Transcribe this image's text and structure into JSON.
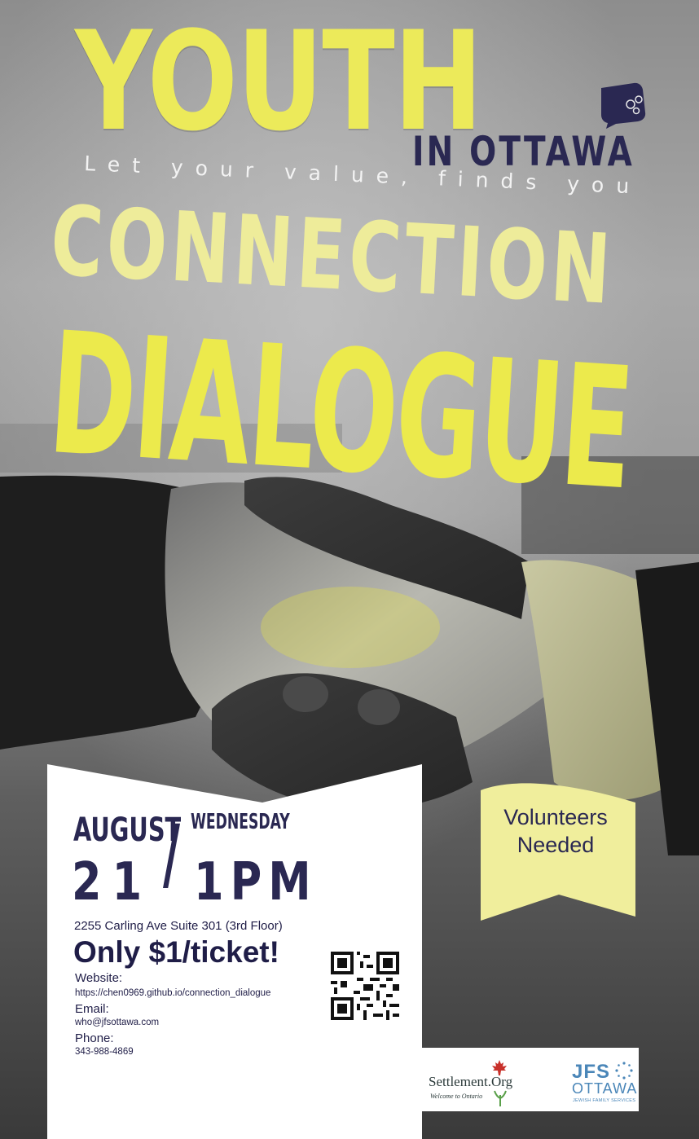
{
  "poster": {
    "title_top": "YOUTH",
    "location": "IN OTTAWA",
    "tagline": "Let your value, finds you",
    "title_mid": "CONNECTION",
    "title_bottom": "DIALOGUE"
  },
  "event": {
    "month": "AUGUST",
    "weekday": "WEDNESDAY",
    "day": "21",
    "time": "1PM",
    "separator": "/",
    "address": "2255 Carling Ave Suite 301 (3rd Floor)",
    "price": "Only $1/ticket!",
    "website_label": "Website:",
    "website": "https://chen0969.github.io/connection_dialogue",
    "email_label": "Email:",
    "email": "who@jfsottawa.com",
    "phone_label": "Phone:",
    "phone": "343-988-4869"
  },
  "ribbon": {
    "line1": "Volunteers",
    "line2": "Needed"
  },
  "logos": {
    "settlement_name": "Settlement.Org",
    "settlement_tagline": "Welcome to Ontario",
    "jfs_name": "JFS",
    "jfs_city": "OTTAWA",
    "jfs_tagline": "JEWISH FAMILY SERVICES"
  },
  "colors": {
    "accent_yellow": "#ecea4c",
    "pale_yellow": "#eeec9a",
    "navy": "#2a2852",
    "ribbon": "#f0ee9c",
    "jfs_blue": "#4a86b8",
    "maple_red": "#c8302a"
  }
}
